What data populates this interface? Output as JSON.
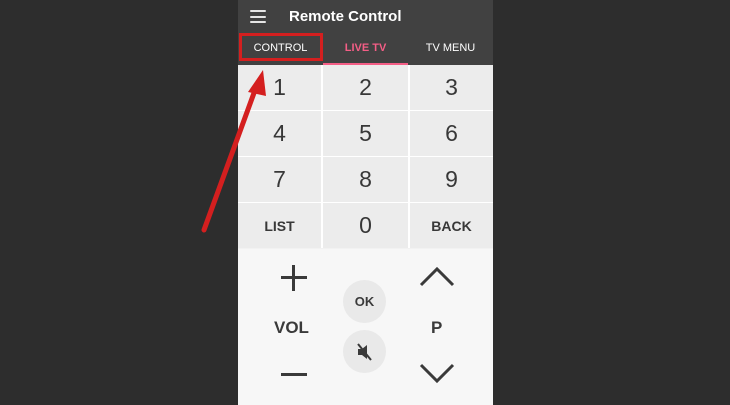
{
  "app": {
    "title": "Remote Control",
    "menu_icon": "hamburger-menu-icon"
  },
  "tabs": [
    {
      "label": "CONTROL",
      "active": false,
      "highlighted": true
    },
    {
      "label": "LIVE TV",
      "active": true
    },
    {
      "label": "TV MENU",
      "active": false
    }
  ],
  "keypad": {
    "keys": [
      "1",
      "2",
      "3",
      "4",
      "5",
      "6",
      "7",
      "8",
      "9",
      "LIST",
      "0",
      "BACK"
    ]
  },
  "controls": {
    "volume_label": "VOL",
    "ok_label": "OK",
    "channel_label": "P",
    "mute_icon": "mute-speaker-icon"
  },
  "colors": {
    "appbar": "#414141",
    "active_tab": "#f45e86",
    "annotation_red": "#d41f1f",
    "background": "#2d2d2d"
  }
}
